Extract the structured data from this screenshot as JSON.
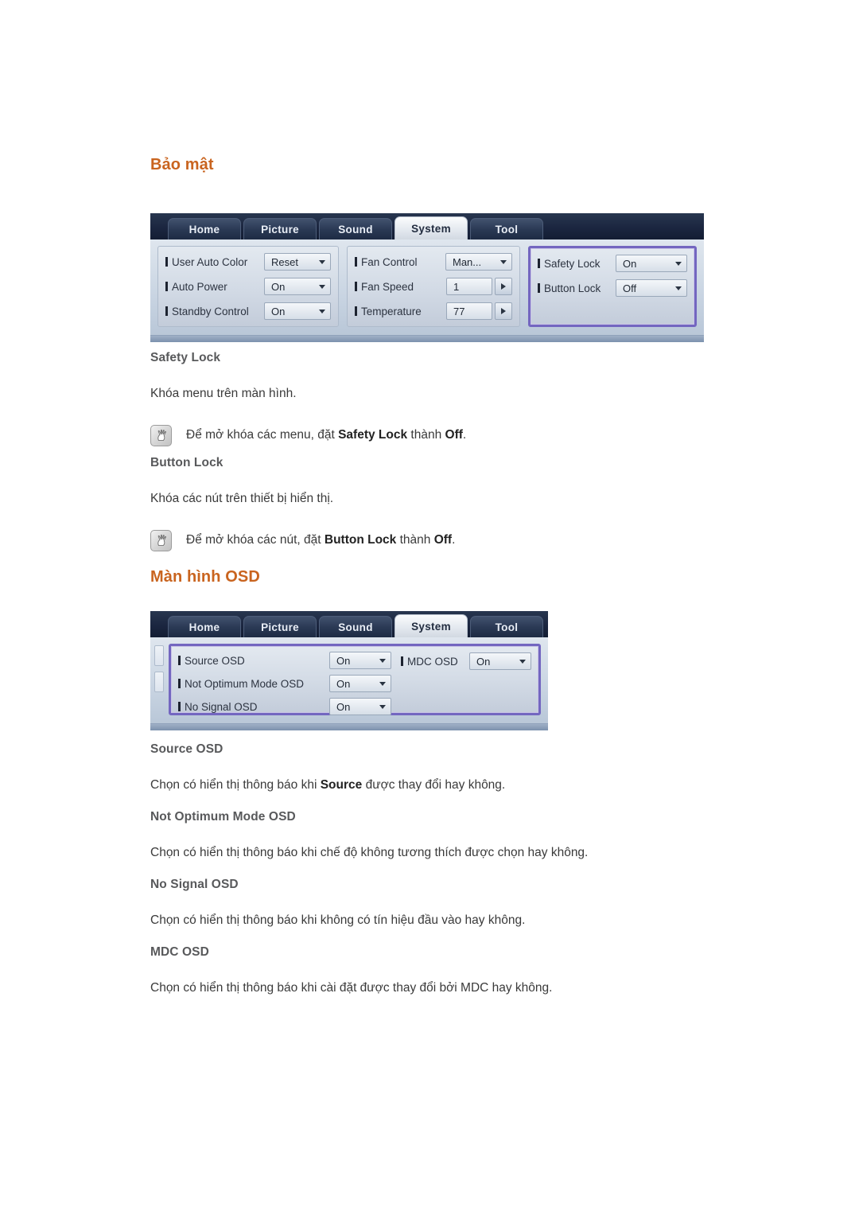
{
  "sections": [
    {
      "heading": "Bảo mật",
      "subsections": [
        {
          "title": "Safety Lock",
          "body": "Khóa menu trên màn hình.",
          "note_prefix": "Để mở khóa các menu, đặt ",
          "note_bold1": "Safety Lock",
          "note_middle": " thành ",
          "note_bold2": "Off",
          "note_suffix": "."
        },
        {
          "title": "Button Lock",
          "body": "Khóa các nút trên thiết bị hiển thị.",
          "note_prefix": "Để mở khóa các nút, đặt ",
          "note_bold1": "Button Lock",
          "note_middle": " thành ",
          "note_bold2": "Off",
          "note_suffix": "."
        }
      ]
    },
    {
      "heading": "Màn hình OSD",
      "subsections": [
        {
          "title": "Source OSD",
          "body_prefix": "Chọn có hiển thị thông báo khi ",
          "body_bold": "Source",
          "body_suffix": " được thay đổi hay không."
        },
        {
          "title": "Not Optimum Mode OSD",
          "body": "Chọn có hiển thị thông báo khi chế độ không tương thích được chọn hay không."
        },
        {
          "title": "No Signal OSD",
          "body": "Chọn có hiển thị thông báo khi không có tín hiệu đầu vào hay không."
        },
        {
          "title": "MDC OSD",
          "body": "Chọn có hiển thị thông báo khi cài đặt được thay đổi bởi MDC hay không."
        }
      ]
    }
  ],
  "osd_security": {
    "tabs": [
      {
        "label": "Home",
        "active": false
      },
      {
        "label": "Picture",
        "active": false
      },
      {
        "label": "Sound",
        "active": false
      },
      {
        "label": "System",
        "active": true
      },
      {
        "label": "Tool",
        "active": false
      }
    ],
    "group_left": [
      {
        "label": "User Auto Color",
        "value": "Reset",
        "control": "combo"
      },
      {
        "label": "Auto Power",
        "value": "On",
        "control": "combo"
      },
      {
        "label": "Standby Control",
        "value": "On",
        "control": "combo"
      }
    ],
    "group_mid": [
      {
        "label": "Fan Control",
        "value": "Man...",
        "control": "combo"
      },
      {
        "label": "Fan Speed",
        "value": "1",
        "control": "spin"
      },
      {
        "label": "Temperature",
        "value": "77",
        "control": "spin"
      }
    ],
    "group_right": [
      {
        "label": "Safety Lock",
        "value": "On",
        "control": "combo"
      },
      {
        "label": "Button Lock",
        "value": "Off",
        "control": "combo"
      }
    ],
    "highlight_color": "#7366C0"
  },
  "osd_menu": {
    "tabs": [
      {
        "label": "Home",
        "active": false
      },
      {
        "label": "Picture",
        "active": false
      },
      {
        "label": "Sound",
        "active": false
      },
      {
        "label": "System",
        "active": true
      },
      {
        "label": "Tool",
        "active": false
      }
    ],
    "column_a": [
      {
        "label": "Source OSD",
        "value": "On",
        "control": "combo"
      },
      {
        "label": "Not Optimum Mode OSD",
        "value": "On",
        "control": "combo"
      },
      {
        "label": "No Signal OSD",
        "value": "On",
        "control": "combo"
      }
    ],
    "column_b": [
      {
        "label": "MDC OSD",
        "value": "On",
        "control": "combo"
      }
    ],
    "highlight_color": "#7366C0"
  },
  "theme": {
    "heading_color": "#C9641F",
    "subheading_color": "#58595B",
    "body_color": "#3A3A3A",
    "tabbar_color": "#1C2A44",
    "panel_color": "#CCD7E4"
  }
}
